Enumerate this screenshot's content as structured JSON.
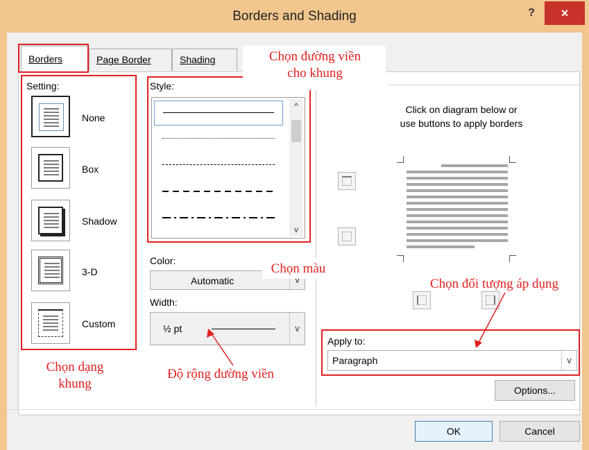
{
  "window": {
    "title": "Borders and Shading",
    "help_label": "?",
    "close_label": "×"
  },
  "tabs": [
    {
      "label": "Borders"
    },
    {
      "label": "Page Border"
    },
    {
      "label": "Shading"
    }
  ],
  "setting": {
    "label": "Setting:",
    "options": [
      {
        "label": "None"
      },
      {
        "label": "Box"
      },
      {
        "label": "Shadow"
      },
      {
        "label": "3-D"
      },
      {
        "label": "Custom"
      }
    ]
  },
  "style": {
    "label": "Style:",
    "scroll_up": "^",
    "scroll_down": "v"
  },
  "color": {
    "label": "Color:",
    "value": "Automatic",
    "arrow": "v"
  },
  "width": {
    "label": "Width:",
    "value": "½ pt",
    "arrow": "v"
  },
  "preview": {
    "instruction_line1": "Click on diagram below or",
    "instruction_line2": "use buttons to apply borders"
  },
  "apply_to": {
    "label": "Apply to:",
    "value": "Paragraph",
    "arrow": "v"
  },
  "buttons": {
    "options": "Options...",
    "ok": "OK",
    "cancel": "Cancel"
  },
  "annotations": {
    "style_note_line1": "Chọn đường viền",
    "style_note_line2": "cho khung",
    "color_note": "Chọn màu",
    "apply_note": "Chọn đối tượng áp dụng",
    "setting_note_line1": "Chọn dạng",
    "setting_note_line2": "khung",
    "width_note": "Độ rộng đường viền"
  },
  "colors": {
    "annotation_red": "#e02020",
    "titlebar": "#f2c68d",
    "close_button": "#c7332b"
  }
}
